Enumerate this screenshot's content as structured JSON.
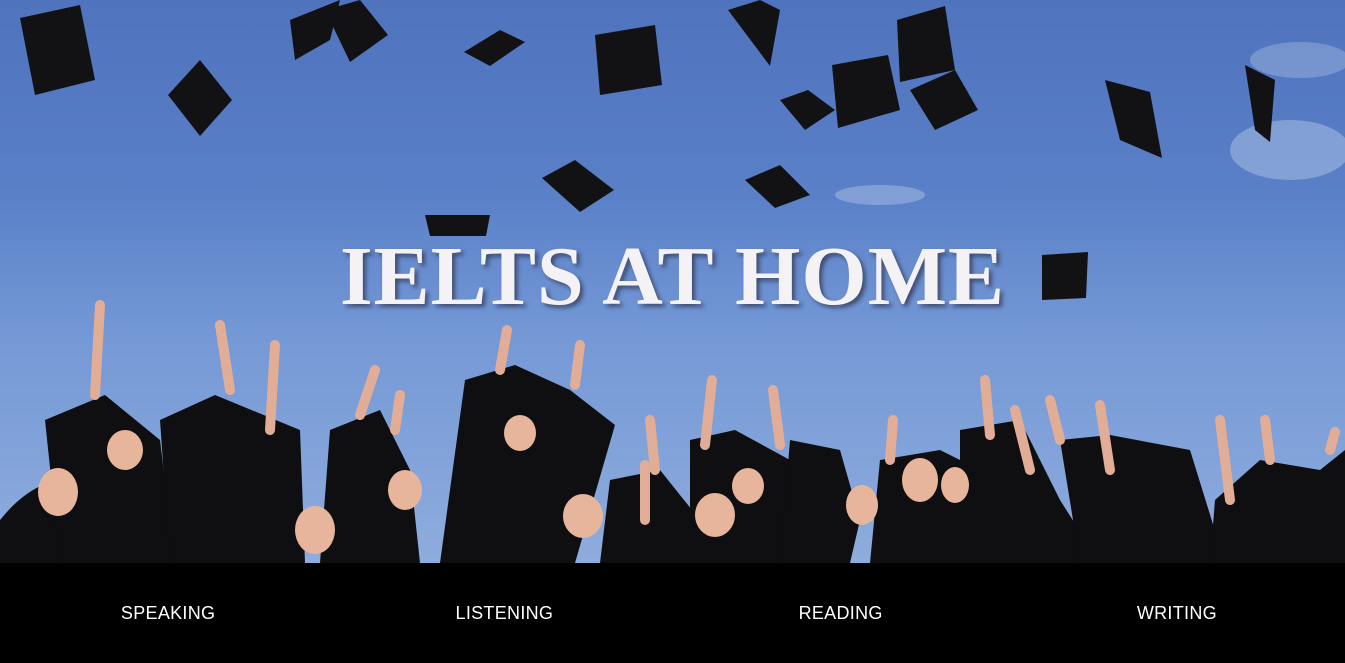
{
  "hero": {
    "title": "IELTS AT HOME",
    "image": "graduates-throwing-caps"
  },
  "nav": {
    "items": [
      {
        "label": "SPEAKING"
      },
      {
        "label": "LISTENING"
      },
      {
        "label": "READING"
      },
      {
        "label": "WRITING"
      }
    ]
  },
  "colors": {
    "sky": "#5a80c8",
    "nav_background": "#000000",
    "nav_text": "#ffffff",
    "title_text": "#f4f2f5"
  }
}
